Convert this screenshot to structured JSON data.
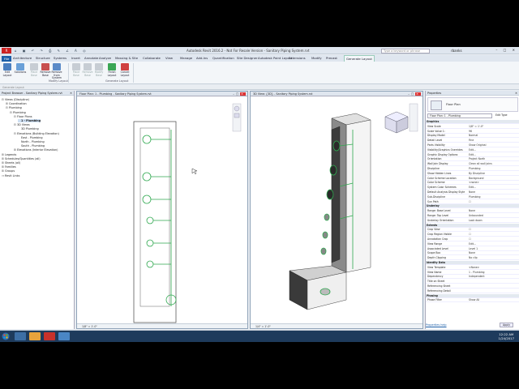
{
  "window": {
    "title": "Autodesk Revit 2016.2 - Not For Resale Version -  Sanitary Piping System.rvt",
    "search_placeholder": "Type a keyword or phrase",
    "user": "rbanks",
    "app_button": "R",
    "quick_access": "⌂ ▣ ↶ ↷ ⎙ ✎ ∠ A ◎",
    "window_controls": "– □ ✕"
  },
  "tabs": [
    "File",
    "Architecture",
    "Structure",
    "Systems",
    "Insert",
    "Annotate",
    "Analyze",
    "Massing & Site",
    "Collaborate",
    "View",
    "Manage",
    "Add-Ins",
    "Quantification",
    "Site Designer",
    "Autodesk Point Layout",
    "Extensions",
    "Modify",
    "Precast",
    "Generate Layout"
  ],
  "ribbon": {
    "buttons": [
      {
        "label": "Edit Layout",
        "icon": "edit-layout-icon",
        "enabled": true
      },
      {
        "label": "Solutions",
        "icon": "solutions-icon",
        "enabled": true
      },
      {
        "label": "Place Base",
        "icon": "place-base-icon",
        "enabled": false
      },
      {
        "label": "Remove Base",
        "icon": "remove-base-icon",
        "enabled": true
      },
      {
        "label": "Remove from System",
        "icon": "remove-from-system-icon",
        "enabled": true
      },
      {
        "label": "Place Base",
        "icon": "place-base-2-icon",
        "enabled": false
      },
      {
        "label": "Remove Base",
        "icon": "remove-base-2-icon",
        "enabled": false
      },
      {
        "label": "Modify Base",
        "icon": "modify-base-icon",
        "enabled": false
      },
      {
        "label": "Solutions",
        "icon": "solutions-2-icon",
        "enabled": false
      },
      {
        "label": "Finish Layout",
        "icon": "finish-layout-icon",
        "enabled": true
      },
      {
        "label": "Cancel Layout",
        "icon": "cancel-layout-icon",
        "enabled": true
      }
    ],
    "panels": [
      "Modify Layout",
      "Generate Layout"
    ]
  },
  "options_bar": "Generate Layout",
  "project_browser": {
    "title": "Project Browser - Sanitary Piping System.rvt",
    "items": [
      {
        "label": "Views (Discipline)",
        "level": 0,
        "ex": "⊟"
      },
      {
        "label": "Coordination",
        "level": 1,
        "ex": "⊞"
      },
      {
        "label": "Plumbing",
        "level": 1,
        "ex": "⊟"
      },
      {
        "label": "Plumbing",
        "level": 2,
        "ex": "⊟"
      },
      {
        "label": "Floor Plans",
        "level": 3,
        "ex": "⊟"
      },
      {
        "label": "1 - Plumbing",
        "level": 4,
        "ex": "",
        "selected": true
      },
      {
        "label": "3D Views",
        "level": 3,
        "ex": "⊟"
      },
      {
        "label": "3D Plumbing",
        "level": 4,
        "ex": ""
      },
      {
        "label": "Elevations (Building Elevation)",
        "level": 3,
        "ex": "⊟"
      },
      {
        "label": "East - Plumbing",
        "level": 4,
        "ex": ""
      },
      {
        "label": "North - Plumbing",
        "level": 4,
        "ex": ""
      },
      {
        "label": "South - Plumbing",
        "level": 4,
        "ex": ""
      },
      {
        "label": "Elevations (Interior Elevation)",
        "level": 3,
        "ex": "⊞"
      },
      {
        "label": "Legends",
        "level": 0,
        "ex": "⊞"
      },
      {
        "label": "Schedules/Quantities (all)",
        "level": 0,
        "ex": "⊞"
      },
      {
        "label": "Sheets (all)",
        "level": 0,
        "ex": "⊞"
      },
      {
        "label": "Families",
        "level": 0,
        "ex": "⊞"
      },
      {
        "label": "Groups",
        "level": 0,
        "ex": "⊞"
      },
      {
        "label": "Revit Links",
        "level": 0,
        "ex": "⊶"
      }
    ]
  },
  "views": {
    "floor_plan": {
      "title": "Floor Plan: 1 - Plumbing - Sanitary Piping System.rvt",
      "scale": "1/8\" = 1'-0\""
    },
    "three_d": {
      "title": "3D View: {3D} - Sanitary Piping System.rvt",
      "scale": "1/4\" = 1'-0\""
    },
    "controls": "– □ ✕"
  },
  "properties": {
    "title": "Properties",
    "type_name": "Floor Plan",
    "selector_value": "Floor Plan: 1 - Plumbing",
    "edit_type": "Edit Type",
    "rows": [
      {
        "k": "Graphics",
        "v": "",
        "group": true
      },
      {
        "k": "View Scale",
        "v": "1/8\" = 1'-0\""
      },
      {
        "k": "Scale Value  1:",
        "v": "96"
      },
      {
        "k": "Display Model",
        "v": "Normal"
      },
      {
        "k": "Detail Level",
        "v": "Fine"
      },
      {
        "k": "Parts Visibility",
        "v": "Show Original"
      },
      {
        "k": "Visibility/Graphics Overrides",
        "v": "Edit..."
      },
      {
        "k": "Graphic Display Options",
        "v": "Edit..."
      },
      {
        "k": "Orientation",
        "v": "Project North"
      },
      {
        "k": "Wall Join Display",
        "v": "Clean all wall joins"
      },
      {
        "k": "Discipline",
        "v": "Plumbing"
      },
      {
        "k": "Show Hidden Lines",
        "v": "By Discipline"
      },
      {
        "k": "Color Scheme Location",
        "v": "Background"
      },
      {
        "k": "Color Scheme",
        "v": "<none>"
      },
      {
        "k": "System Color Schemes",
        "v": "Edit..."
      },
      {
        "k": "Default Analysis Display Style",
        "v": "None"
      },
      {
        "k": "Sub-Discipline",
        "v": "Plumbing"
      },
      {
        "k": "Sun Path",
        "v": "☐"
      },
      {
        "k": "Underlay",
        "v": "",
        "group": true
      },
      {
        "k": "Range: Base Level",
        "v": "None"
      },
      {
        "k": "Range: Top Level",
        "v": "Unbounded"
      },
      {
        "k": "Underlay Orientation",
        "v": "Look down"
      },
      {
        "k": "Extents",
        "v": "",
        "group": true
      },
      {
        "k": "Crop View",
        "v": "☐"
      },
      {
        "k": "Crop Region Visible",
        "v": "☐"
      },
      {
        "k": "Annotation Crop",
        "v": "☐"
      },
      {
        "k": "View Range",
        "v": "Edit..."
      },
      {
        "k": "Associated Level",
        "v": "Level 1"
      },
      {
        "k": "Scope Box",
        "v": "None"
      },
      {
        "k": "Depth Clipping",
        "v": "No clip"
      },
      {
        "k": "Identity Data",
        "v": "",
        "group": true
      },
      {
        "k": "View Template",
        "v": "<None>"
      },
      {
        "k": "View Name",
        "v": "1 - Plumbing"
      },
      {
        "k": "Dependency",
        "v": "Independent"
      },
      {
        "k": "Title on Sheet",
        "v": ""
      },
      {
        "k": "Referencing Sheet",
        "v": ""
      },
      {
        "k": "Referencing Detail",
        "v": ""
      },
      {
        "k": "Phasing",
        "v": "",
        "group": true
      },
      {
        "k": "Phase Filter",
        "v": "Show All"
      }
    ],
    "help_link": "Properties help",
    "apply": "Apply"
  },
  "status_bar": {
    "message": "Ready",
    "model": "Main Model"
  },
  "taskbar": {
    "time": "12:22 AM",
    "date": "1/24/2017"
  },
  "colors": {
    "accent": "#1c5fa8",
    "pipe_green": "#2fa84f",
    "taskbar": "#1e3b5c"
  }
}
